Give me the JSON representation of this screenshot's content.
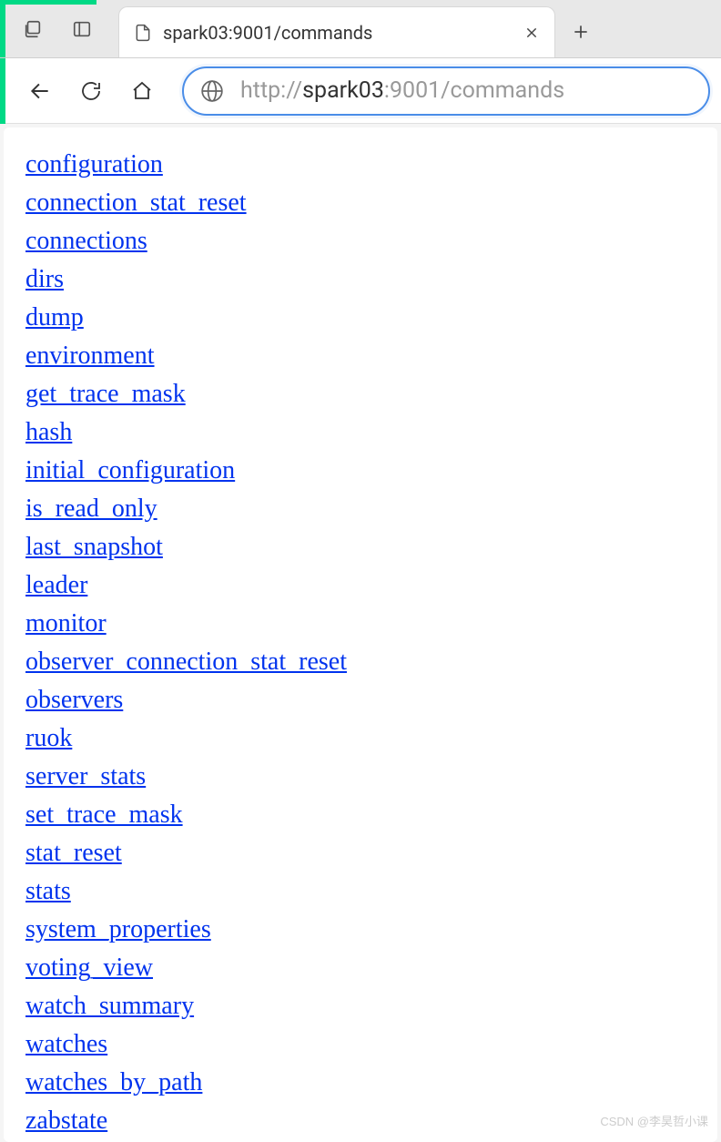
{
  "browser": {
    "tab": {
      "title": "spark03:9001/commands"
    },
    "address": {
      "prefix": "http://",
      "host": "spark03",
      "port_path": ":9001/commands"
    }
  },
  "commands": [
    "configuration",
    "connection_stat_reset",
    "connections",
    "dirs",
    "dump",
    "environment",
    "get_trace_mask",
    "hash",
    "initial_configuration",
    "is_read_only",
    "last_snapshot",
    "leader",
    "monitor",
    "observer_connection_stat_reset",
    "observers",
    "ruok",
    "server_stats",
    "set_trace_mask",
    "stat_reset",
    "stats",
    "system_properties",
    "voting_view",
    "watch_summary",
    "watches",
    "watches_by_path",
    "zabstate"
  ],
  "watermark": "CSDN @李昊哲小课"
}
